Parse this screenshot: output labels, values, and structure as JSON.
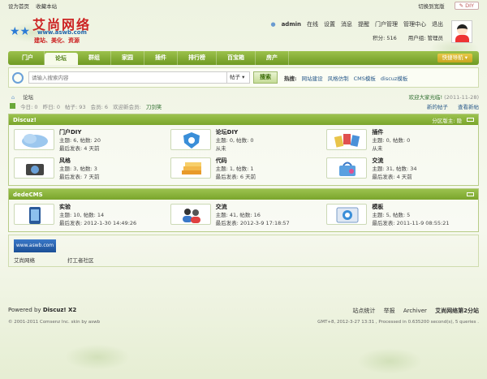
{
  "topbar": {
    "home_link": "设为首页",
    "fav_link": "收藏本站",
    "style_link": "切换到宽版",
    "diy": "DIY"
  },
  "logo": {
    "title": "艾尚网络",
    "url": "www.aswb.com",
    "slogan": "建站、美化、资源"
  },
  "user": {
    "name": "admin",
    "status": "在线",
    "links": [
      "设置",
      "消息",
      "提醒",
      "门户管理",
      "管理中心",
      "退出"
    ],
    "credits": "积分: 516",
    "group": "用户组: 管理员"
  },
  "nav": {
    "items": [
      "门户",
      "论坛",
      "群组",
      "家园",
      "插件",
      "排行榜",
      "百宝箱",
      "房产"
    ],
    "quick": "快捷导航"
  },
  "search": {
    "placeholder": "请输入搜索内容",
    "type": "帖子",
    "button": "搜索",
    "hot_label": "热搜:",
    "hot": [
      "网站建设",
      "风格仿制",
      "CMS模板",
      "discuz模板"
    ]
  },
  "breadcrumb": {
    "current": "论坛",
    "notice": "欢迎大家光临!",
    "notice_date": "(2011-11-28)"
  },
  "stats": {
    "today": "今日: 0",
    "yesterday": "昨日: 0",
    "posts": "帖子: 93",
    "members": "会员: 6",
    "welcome": "欢迎新会员:",
    "new_member": "刀剑笑",
    "new_posts": "新的帖子",
    "view_new": "查看新帖"
  },
  "categories": [
    {
      "title": "Discuz!",
      "moderator": "分区版主: 隐",
      "forums": [
        {
          "name": "门户DIY",
          "stats": "主题: 6, 帖数: 20",
          "last": "最后发表: 4 天前",
          "icon": "cloud-icon"
        },
        {
          "name": "论坛DIY",
          "stats": "主题: 0, 帖数: 0",
          "last": "从未",
          "icon": "shield-icon"
        },
        {
          "name": "插件",
          "stats": "主题: 0, 帖数: 0",
          "last": "从未",
          "icon": "cards-icon"
        },
        {
          "name": "风格",
          "stats": "主题: 3, 帖数: 3",
          "last": "最后发表: 7 天前",
          "icon": "camera-icon"
        },
        {
          "name": "代码",
          "stats": "主题: 1, 帖数: 1",
          "last": "最后发表: 6 天前",
          "icon": "books-icon"
        },
        {
          "name": "交流",
          "stats": "主题: 31, 帖数: 34",
          "last": "最后发表: 4 天前",
          "icon": "bag-icon"
        }
      ]
    },
    {
      "title": "dedeCMS",
      "moderator": "",
      "forums": [
        {
          "name": "实验",
          "stats": "主题: 10, 帖数: 14",
          "last": "最后发表: 2012-1-30 14:49:26",
          "icon": "phone-icon"
        },
        {
          "name": "交流",
          "stats": "主题: 41, 帖数: 16",
          "last": "最后发表: 2012-3-9 17:18:57",
          "icon": "users-icon"
        },
        {
          "name": "模板",
          "stats": "主题: 5, 帖数: 5",
          "last": "最后发表: 2011-11-9 08:55:21",
          "icon": "browser-icon"
        }
      ]
    }
  ],
  "links": [
    {
      "name": "艾尚网络",
      "logo": "www.aswb.com"
    },
    {
      "name": "打工者社区",
      "logo": ""
    }
  ],
  "footer": {
    "powered": "Powered by",
    "brand": "Discuz! X2",
    "copyright": "© 2001-2011 Comsenz Inc. skin by aswb",
    "links": [
      "站点统计",
      "举报",
      "Archiver",
      "艾尚网络第2分站"
    ],
    "time": "GMT+8, 2012-3-27 13:31 , Processed in 0.635200 second(s), 5 queries ."
  }
}
